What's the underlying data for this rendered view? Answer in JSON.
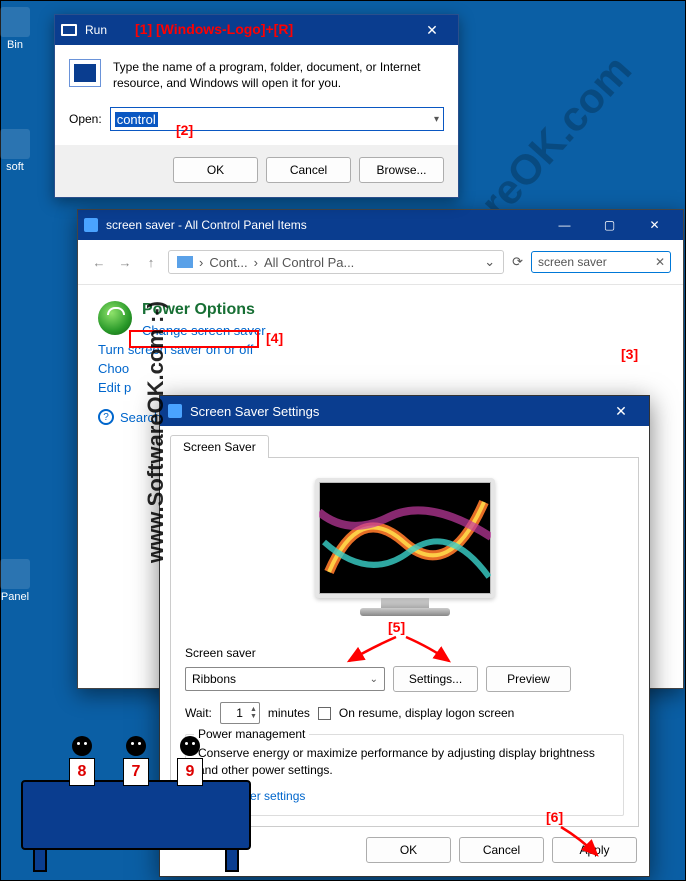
{
  "desktop": {
    "bin": "Bin",
    "soft": "soft",
    "panel": "Panel"
  },
  "annots": {
    "a1": "[1]  [Windows-Logo]+[R]",
    "a2": "[2]",
    "a3": "[3]",
    "a4": "[4]",
    "a5": "[5]",
    "a6": "[6]"
  },
  "watermark": "www.SoftwareOK.com  :-)",
  "watermark2": "SoftwareOK.com",
  "run": {
    "title": "Run",
    "desc": "Type the name of a program, folder, document, or Internet resource, and Windows will open it for you.",
    "open_label": "Open:",
    "value": "control",
    "ok": "OK",
    "cancel": "Cancel",
    "browse": "Browse..."
  },
  "cp": {
    "title": "screen saver - All Control Panel Items",
    "crumb1": "Cont...",
    "crumb2": "All Control Pa...",
    "search_value": "screen saver",
    "heading": "Power Options",
    "links": {
      "l1": "Change screen saver",
      "l2": "Turn screen saver on or off",
      "l3": "Choo",
      "l4": "Edit p"
    },
    "searchhelp": "Search Wi"
  },
  "ss": {
    "title": "Screen Saver Settings",
    "tab": "Screen Saver",
    "section_label": "Screen saver",
    "selected": "Ribbons",
    "settings_btn": "Settings...",
    "preview_btn": "Preview",
    "wait_label": "Wait:",
    "wait_value": "1",
    "minutes": "minutes",
    "resume": "On resume, display logon screen",
    "pm_legend": "Power management",
    "pm_text": "Conserve energy or maximize performance by adjusting display brightness and other power settings.",
    "pm_link": "ange power settings",
    "ok": "OK",
    "cancel": "Cancel",
    "apply": "Apply"
  },
  "cards": {
    "c1": "8",
    "c2": "7",
    "c3": "9"
  }
}
